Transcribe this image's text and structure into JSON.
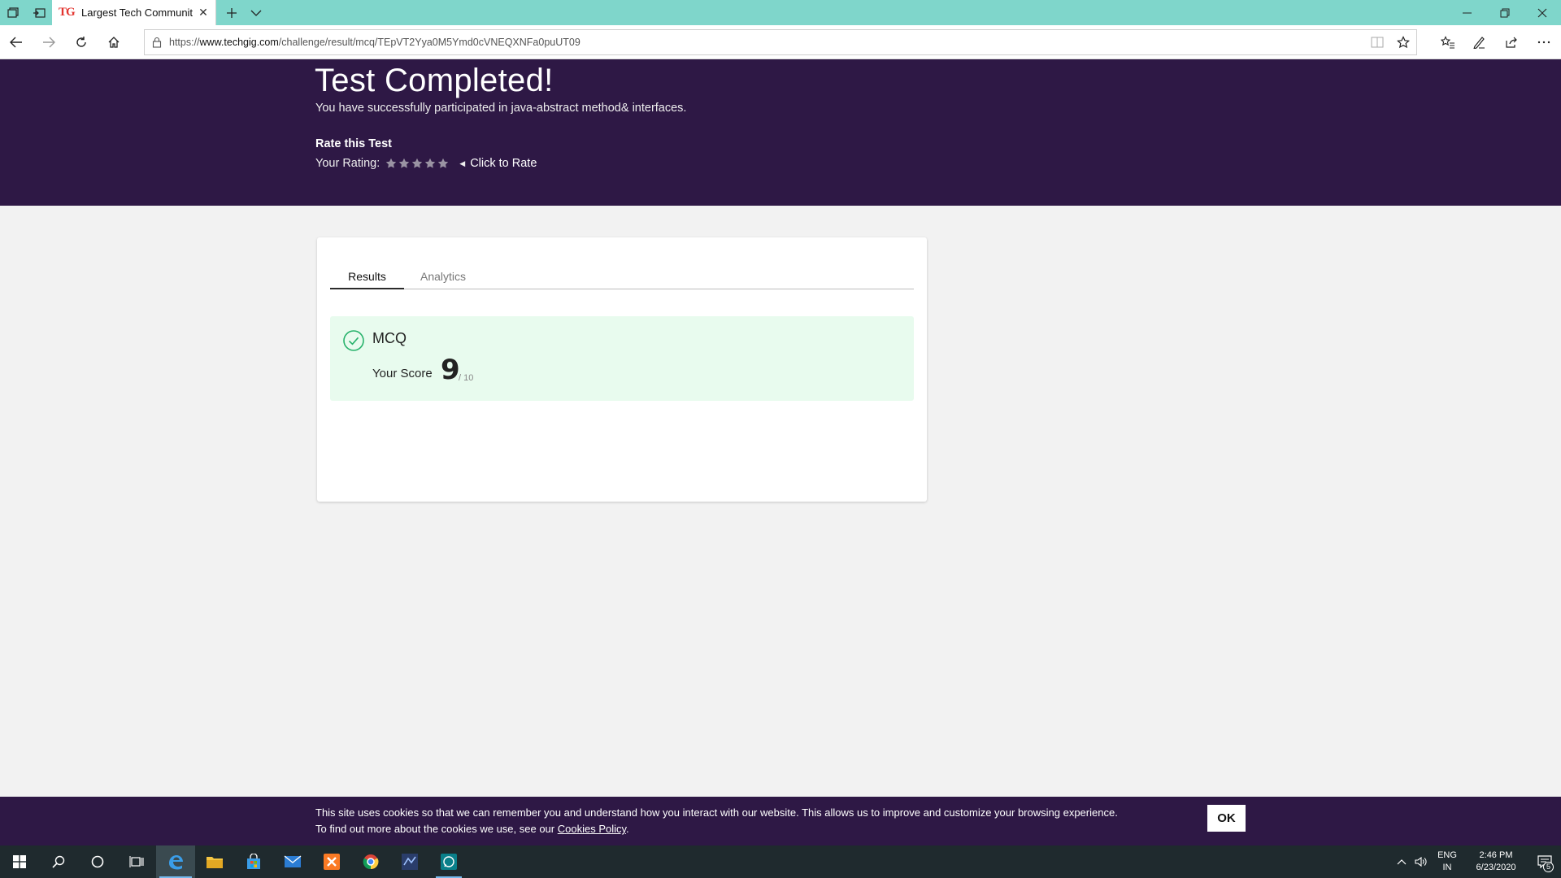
{
  "browser": {
    "tab_favicon_text": "TG",
    "tab_title": "Largest Tech Communit",
    "url_prefix": "https://",
    "url_host": "www.techgig.com",
    "url_path": "/challenge/result/mcq/TEpVT2Yya0M5Ymd0cVNEQXNFa0puUT09",
    "accent_color": "#7fd6cb"
  },
  "hero": {
    "title": "Test Completed!",
    "subtitle": "You have successfully participated in java-abstract method& interfaces.",
    "rate_heading": "Rate this Test",
    "rating_label": "Your Rating:",
    "rating_stars_total": 5,
    "rate_link": "Click to Rate",
    "background_color": "#2e1845"
  },
  "card": {
    "tabs": [
      {
        "label": "Results",
        "active": true
      },
      {
        "label": "Analytics",
        "active": false
      }
    ],
    "result": {
      "title": "MCQ",
      "score_label": "Your Score",
      "score": "9",
      "total": "/ 10",
      "status_color": "#27b26b"
    }
  },
  "cookie": {
    "line1": "This site uses cookies so that we can remember you and understand how you interact with our website. This allows us to improve and customize your browsing experience.",
    "line2_prefix": "To find out more about the cookies we use, see our ",
    "link": "Cookies Policy",
    "line2_suffix": ".",
    "ok_label": "OK"
  },
  "taskbar": {
    "lang_line1": "ENG",
    "lang_line2": "IN",
    "time": "2:46 PM",
    "date": "6/23/2020",
    "notification_count": "5"
  }
}
